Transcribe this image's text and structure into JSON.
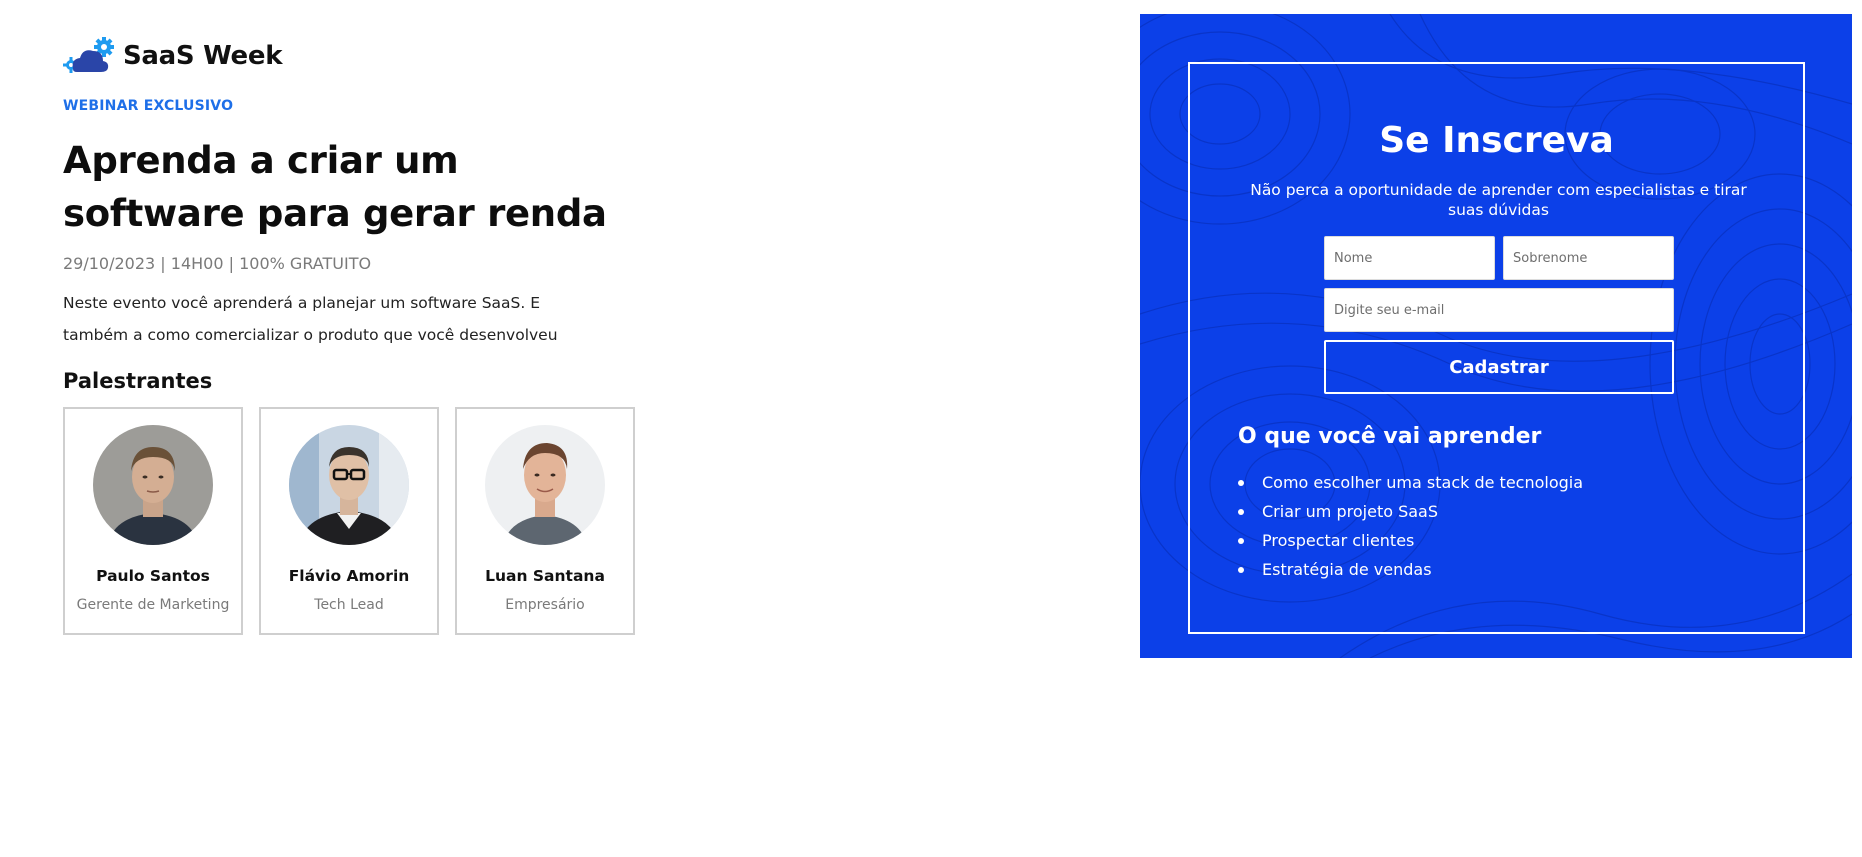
{
  "brand": {
    "name": "SaaS Week",
    "logo_icon": "cloud-gear-icon"
  },
  "hero": {
    "eyebrow": "WEBINAR EXCLUSIVO",
    "headline_line1": "Aprenda a criar um",
    "headline_line2": "software para gerar renda",
    "meta": "29/10/2023 | 14H00 | 100% GRATUITO",
    "description": "Neste evento você aprenderá a planejar um software SaaS. E também a como comercializar o produto que você desenvolveu"
  },
  "speakers": {
    "title": "Palestrantes",
    "items": [
      {
        "name": "Paulo Santos",
        "role": "Gerente de Marketing"
      },
      {
        "name": "Flávio Amorin",
        "role": "Tech Lead"
      },
      {
        "name": "Luan Santana",
        "role": "Empresário"
      }
    ]
  },
  "signup": {
    "title": "Se Inscreva",
    "subtitle": "Não perca a oportunidade de aprender com especialistas e tirar suas dúvidas",
    "first_name_placeholder": "Nome",
    "last_name_placeholder": "Sobrenome",
    "email_placeholder": "Digite seu e-mail",
    "submit_label": "Cadastrar"
  },
  "learn": {
    "title": "O que você vai aprender",
    "items": [
      "Como escolher uma stack de tecnologia",
      "Criar um projeto SaaS",
      "Prospectar clientes",
      "Estratégia de vendas"
    ]
  },
  "colors": {
    "accent": "#1e6fe8",
    "panel": "#0c40e8",
    "text": "#111111",
    "muted": "#7a7a7a"
  }
}
